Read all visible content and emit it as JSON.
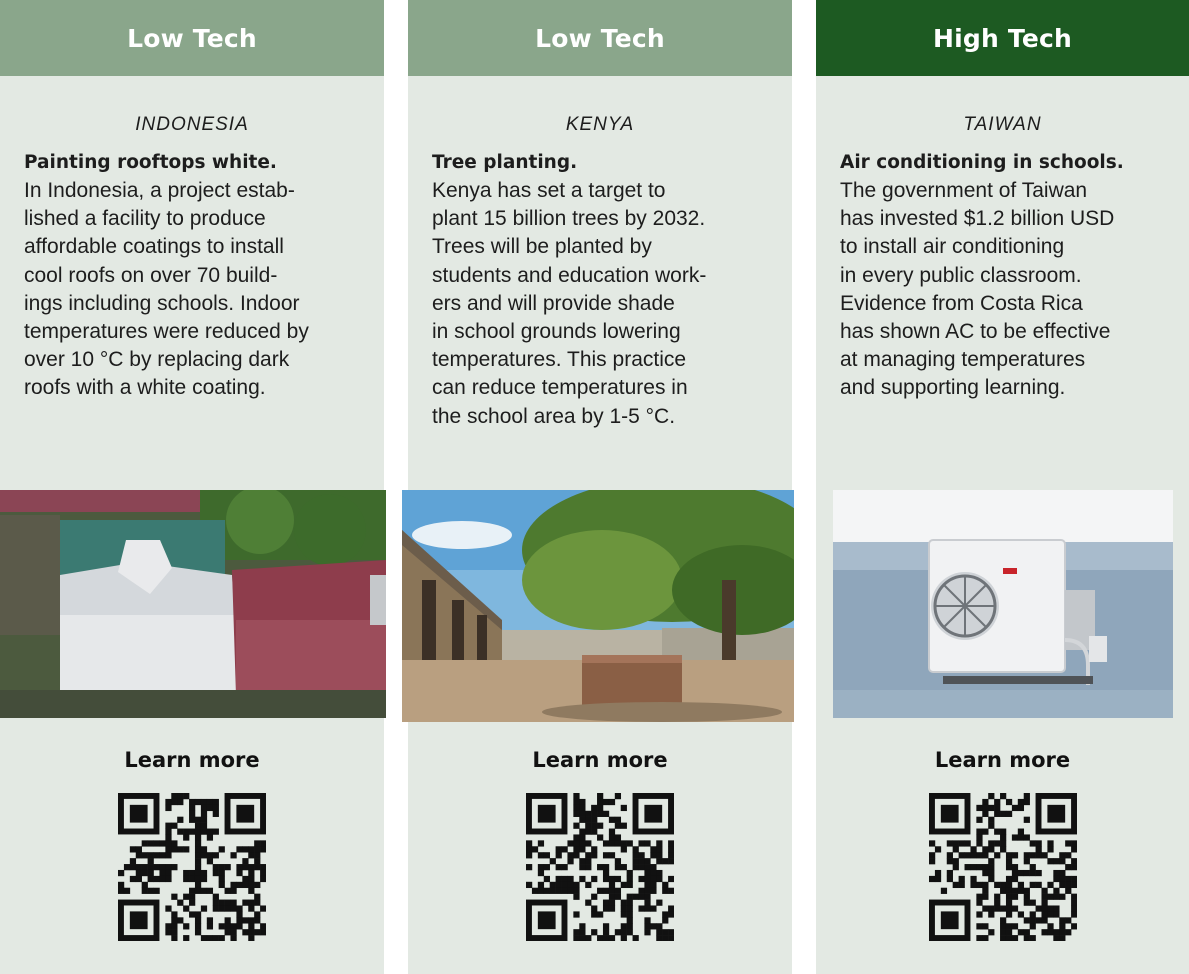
{
  "cards": [
    {
      "tag": "Low Tech",
      "country": "INDONESIA",
      "headline": "Painting rooftops white.",
      "body_lines": [
        "In Indonesia, a project estab-",
        "lished a facility to produce",
        "affordable coatings to install",
        "cool roofs on over 70 build-",
        "ings including schools. Indoor",
        "temperatures were reduced by",
        "over 10 °C by replacing dark",
        "roofs with a white coating."
      ],
      "learn_more": "Learn more",
      "header_color": "#8aa68b"
    },
    {
      "tag": "Low Tech",
      "country": "KENYA",
      "headline": "Tree planting.",
      "body_lines": [
        "Kenya has set a target to",
        "plant 15 billion trees by 2032.",
        "Trees will be planted by",
        "students and education work-",
        "ers and will provide shade",
        "in school grounds lowering",
        "temperatures. This practice",
        "can reduce temperatures in",
        "the school area by 1-5 °C."
      ],
      "learn_more": "Learn more",
      "header_color": "#8aa68b"
    },
    {
      "tag": "High Tech",
      "country": "TAIWAN",
      "headline": "Air conditioning in schools.",
      "body_lines": [
        "The government of Taiwan",
        "has invested $1.2 billion USD",
        "to install air conditioning",
        "in every public classroom.",
        "Evidence from Costa Rica",
        "has shown AC to be effective",
        "at managing temperatures",
        "and supporting learning."
      ],
      "learn_more": "Learn more",
      "header_color": "#1d5a22"
    }
  ]
}
